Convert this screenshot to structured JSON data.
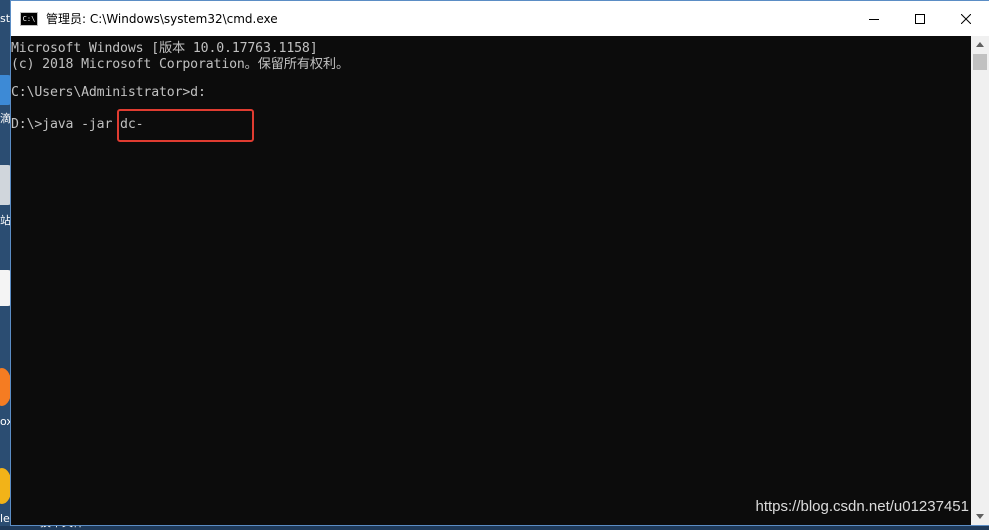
{
  "window": {
    "title": "管理员: C:\\Windows\\system32\\cmd.exe",
    "icon": "cmd-icon",
    "icon_text": "C:\\"
  },
  "console": {
    "lines": [
      "Microsoft Windows [版本 10.0.17763.1158]",
      "(c) 2018 Microsoft Corporation。保留所有权利。",
      "",
      "C:\\Users\\Administrator>d:",
      "",
      "D:\\>java -jar dc-"
    ]
  },
  "desktop": {
    "labels": [
      "str",
      "滴",
      "站",
      "ox",
      "le"
    ],
    "taskbar_text": "技术文件"
  },
  "watermark": "https://blog.csdn.net/u01237451",
  "colors": {
    "console_bg": "#0c0c0c",
    "console_text": "#c0c0c0",
    "highlight": "#e03c31"
  }
}
